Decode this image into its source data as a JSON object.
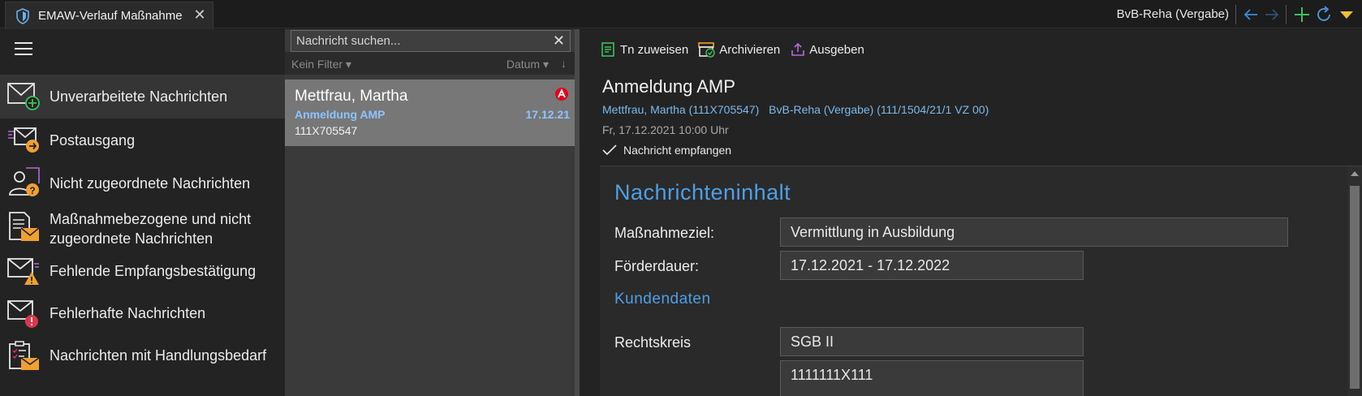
{
  "window": {
    "tab_title": "EMAW-Verlauf Maßnahme",
    "context": "BvB-Reha (Vergabe)",
    "colors": {
      "accent_blue": "#4e9fe6",
      "add_green": "#3fbf5f",
      "dropdown_yellow": "#f2c12e"
    }
  },
  "nav": {
    "items": [
      {
        "label": "Unverarbeitete Nachrichten",
        "icon": "mail-add-icon",
        "active": true
      },
      {
        "label": "Postausgang",
        "icon": "mail-outbox-icon"
      },
      {
        "label": "Nicht zugeordnete Nachrichten",
        "icon": "user-unknown-icon"
      },
      {
        "label_line1": "Maßnahmebezogene und nicht",
        "label_line2": "zugeordnete Nachrichten",
        "icon": "document-mail-icon"
      },
      {
        "label": "Fehlende Empfangsbestätigung",
        "icon": "mail-warning-icon"
      },
      {
        "label": "Fehlerhafte Nachrichten",
        "icon": "mail-error-icon"
      },
      {
        "label": "Nachrichten mit Handlungsbedarf",
        "icon": "clipboard-mail-icon"
      }
    ]
  },
  "list": {
    "search_placeholder": "Nachricht suchen...",
    "filter_label": "Kein Filter",
    "sort_label": "Datum",
    "messages": [
      {
        "name": "Mettfrau, Martha",
        "subject": "Anmeldung AMP",
        "date": "17.12.21",
        "id": "111X705547"
      }
    ]
  },
  "detail": {
    "actions": {
      "assign": "Tn zuweisen",
      "archive": "Archivieren",
      "export": "Ausgeben"
    },
    "title": "Anmeldung AMP",
    "person_link": "Mettfrau, Martha (111X705547)",
    "measure_link": "BvB-Reha (Vergabe) (111/1504/21/1 VZ 00)",
    "datetime": "Fr, 17.12.2021 10:00 Uhr",
    "status": "Nachricht empfangen",
    "content": {
      "section_title": "Nachrichteninhalt",
      "goal_label": "Maßnahmeziel:",
      "goal_value": "Vermittlung in Ausbildung",
      "duration_label": "Förderdauer:",
      "duration_value": "17.12.2021 - 17.12.2022",
      "customer_title": "Kundendaten",
      "legal_label": "Rechtskreis",
      "legal_value": "SGB II",
      "next_value": "1111111X111"
    }
  }
}
